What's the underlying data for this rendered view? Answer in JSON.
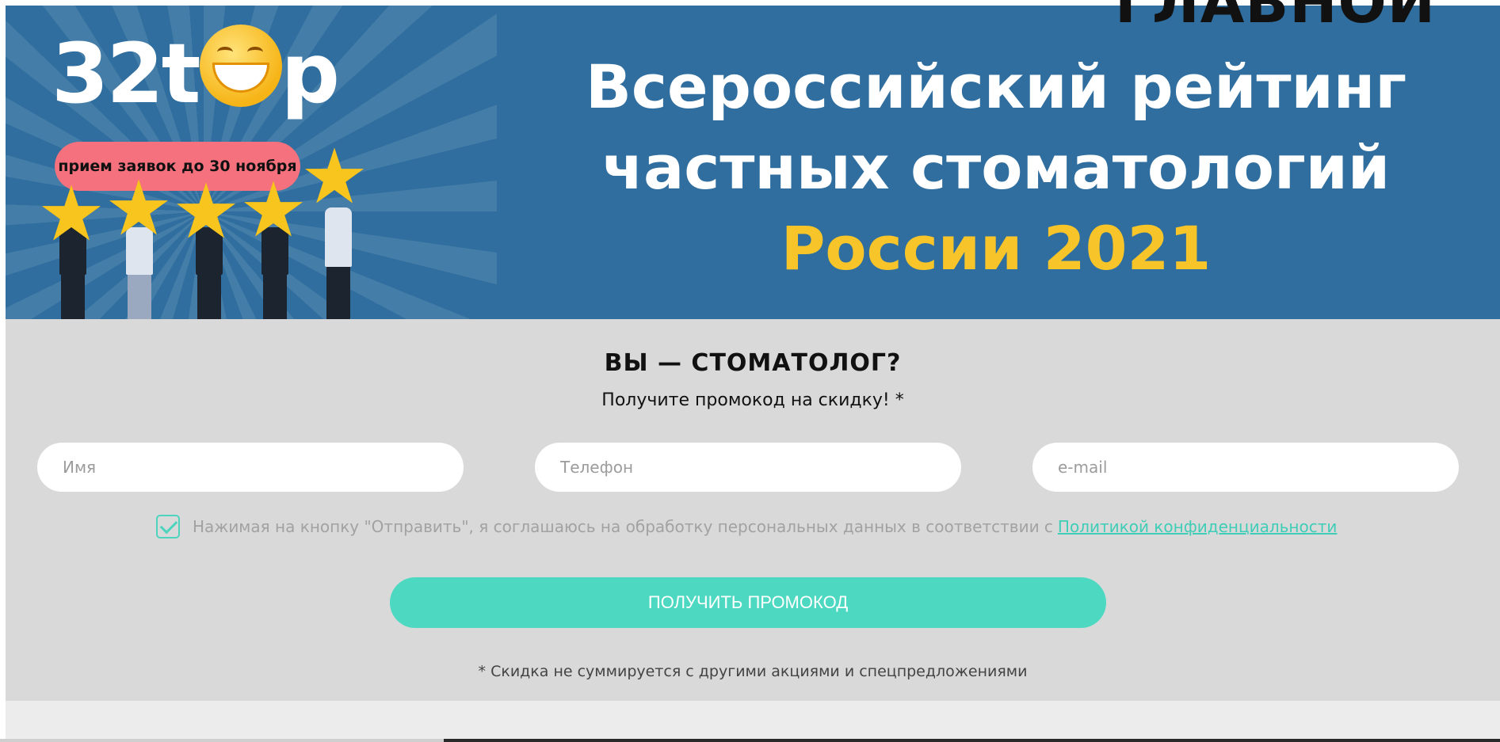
{
  "page": {
    "cut_heading": "ГЛАВНОЙ"
  },
  "banner": {
    "logo": {
      "prefix": "32t",
      "suffix": "p"
    },
    "deadline_pill": "прием заявок до 30 ноября",
    "title_line1": "Всероссийский рейтинг",
    "title_line2": "частных стоматологий",
    "title_line3": "России 2021",
    "colors": {
      "background": "#2f6e9e",
      "accent": "#f7c529",
      "pill": "#f4717d"
    }
  },
  "form": {
    "heading": "ВЫ — СТОМАТОЛОГ?",
    "subheading": "Получите промокод на скидку! *",
    "name_placeholder": "Имя",
    "phone_placeholder": "Телефон",
    "email_placeholder": "e-mail",
    "consent_checked": true,
    "consent_text": "Нажимая на кнопку \"Отправить\", я соглашаюсь на обработку персональных данных в соответствии с",
    "consent_link": "Политикой конфиденциальности",
    "submit_label": "ПОЛУЧИТЬ ПРОМОКОД",
    "footnote": "* Скидка не суммируется с другими акциями и спецпредложениями",
    "colors": {
      "background": "#d9d9d9",
      "button": "#4dd9c1",
      "link": "#3fcdb7"
    }
  }
}
